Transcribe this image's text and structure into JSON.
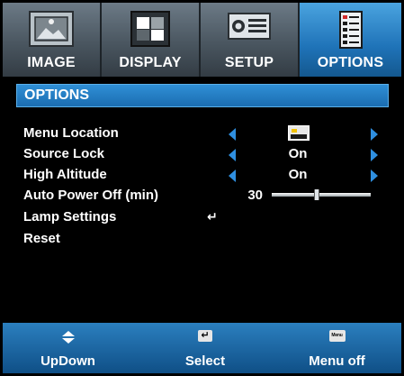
{
  "tabs": [
    {
      "label": "IMAGE",
      "icon": "image-icon"
    },
    {
      "label": "DISPLAY",
      "icon": "display-icon"
    },
    {
      "label": "SETUP",
      "icon": "setup-icon"
    },
    {
      "label": "OPTIONS",
      "icon": "options-icon",
      "active": true
    }
  ],
  "title": "OPTIONS",
  "rows": [
    {
      "label": "Menu Location",
      "value_icon": "menu-location-icon",
      "arrows": true
    },
    {
      "label": "Source Lock",
      "value": "On",
      "arrows": true
    },
    {
      "label": "High Altitude",
      "value": "On",
      "arrows": true
    },
    {
      "label": "Auto Power Off (min)",
      "value": "30",
      "slider_fraction": 0.45
    },
    {
      "label": "Lamp Settings",
      "value_icon": "enter-icon",
      "glyph": "↵"
    },
    {
      "label": "Reset"
    }
  ],
  "footer": [
    {
      "label": "UpDown",
      "icon": "updown-icon"
    },
    {
      "label": "Select",
      "icon": "enter-key-icon",
      "key": "↵"
    },
    {
      "label": "Menu off",
      "icon": "menu-key-icon",
      "key": "Menu"
    }
  ],
  "colors": {
    "active_tab": "#1f73b8",
    "title_bar": "#2f8fd6",
    "arrow": "#2f8fe0",
    "footer": "#1b6aa8"
  }
}
